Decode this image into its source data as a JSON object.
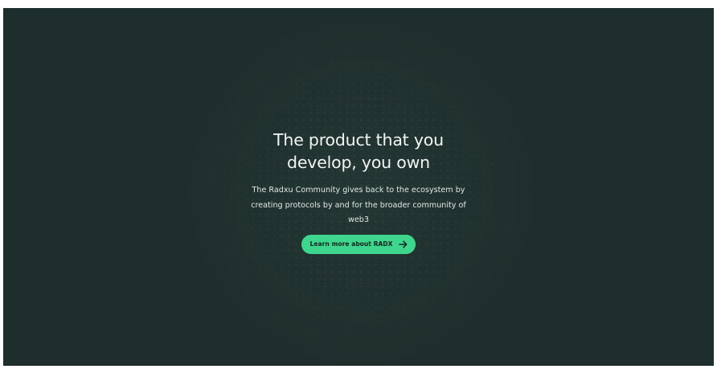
{
  "hero": {
    "headline_line1": "The product that you",
    "headline_line2": "develop, you own",
    "description": "The Radxu Community gives back to the ecosystem by creating protocols by and for the broader community of web3",
    "cta_label": "Learn more about RADX",
    "cta_icon": "arrow-right-icon"
  },
  "colors": {
    "background": "#1e2e2c",
    "accent": "#3dd68c",
    "text": "#f2f4f3"
  }
}
